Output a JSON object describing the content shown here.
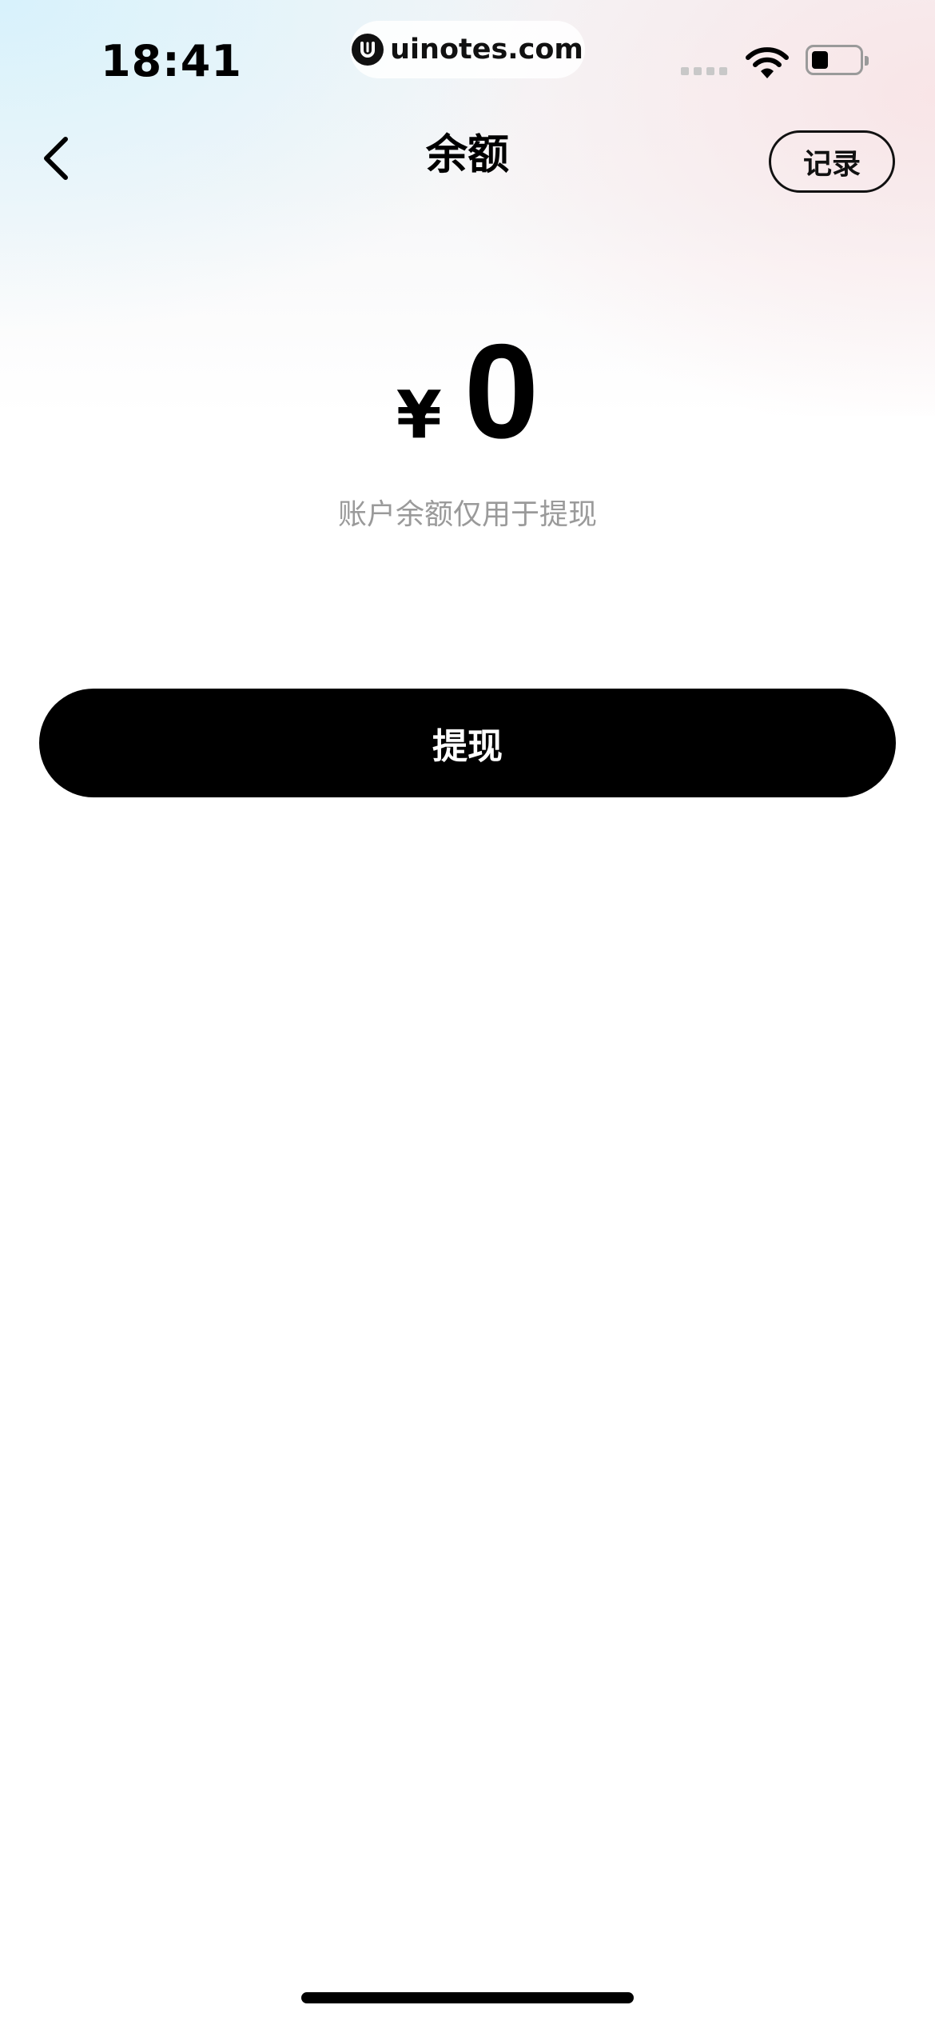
{
  "status_bar": {
    "time": "18:41",
    "url": "uinotes.com"
  },
  "nav": {
    "title": "余额",
    "record_label": "记录"
  },
  "balance": {
    "currency": "¥",
    "amount": "0",
    "note": "账户余额仅用于提现"
  },
  "actions": {
    "withdraw_label": "提现"
  },
  "icons": {
    "back": "chevron-left-icon",
    "wifi": "wifi-icon",
    "battery": "battery-icon",
    "site_logo": "uinotes-logo-icon"
  },
  "colors": {
    "primary_button": "#000000",
    "primary_button_text": "#ffffff",
    "secondary_text": "#9a9a9a"
  }
}
